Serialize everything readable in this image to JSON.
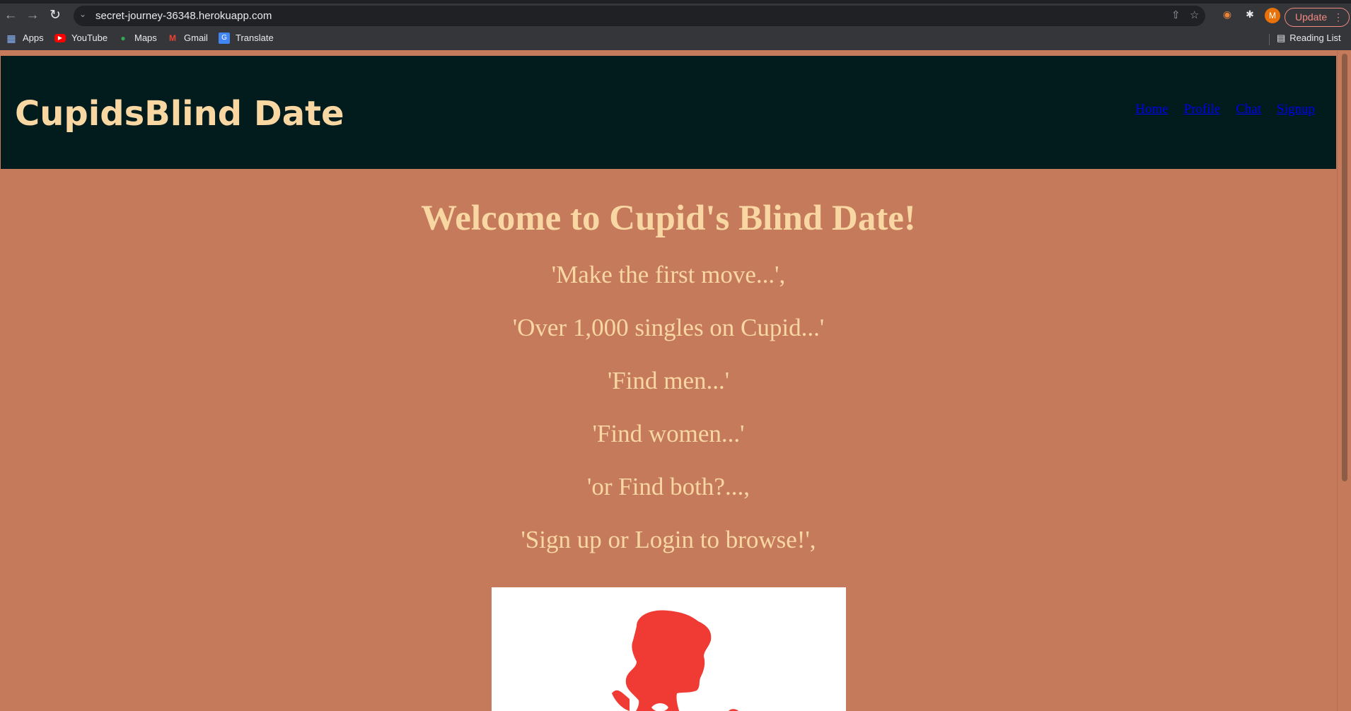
{
  "browser": {
    "url": "secret-journey-36348.herokuapp.com",
    "update_label": "Update",
    "profile_initial": "M",
    "bookmarks": [
      {
        "label": "Apps",
        "icon": "apps-grid-icon"
      },
      {
        "label": "YouTube",
        "icon": "youtube-icon"
      },
      {
        "label": "Maps",
        "icon": "maps-icon"
      },
      {
        "label": "Gmail",
        "icon": "gmail-icon"
      },
      {
        "label": "Translate",
        "icon": "translate-icon"
      }
    ],
    "reading_list_label": "Reading List"
  },
  "site": {
    "brand": "CupidsBlind Date",
    "nav": [
      "Home",
      "Profile",
      "Chat",
      "Signup"
    ],
    "welcome": "Welcome to Cupid's Blind Date!",
    "taglines": [
      "'Make the first move...',",
      "'Over 1,000 singles on Cupid...'",
      "'Find men...'",
      "'Find women...'",
      "'or Find both?...,",
      "'Sign up or Login to browse!',"
    ]
  },
  "colors": {
    "page_bg": "#c67a5c",
    "header_bg": "#021b1d",
    "text_cream": "#f8d7a3",
    "cupid_red": "#ef3b33"
  }
}
